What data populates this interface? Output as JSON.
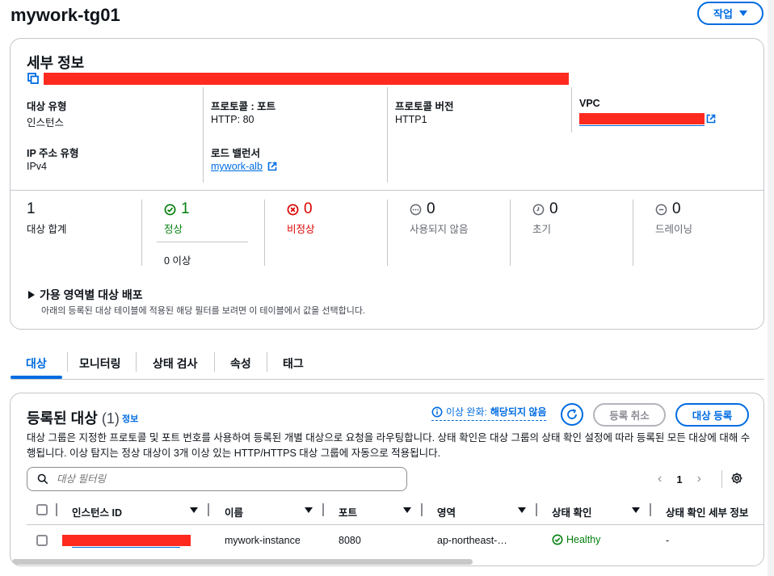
{
  "page": {
    "title": "mywork-tg01",
    "actions_label": "작업"
  },
  "details": {
    "title": "세부 정보",
    "fields": {
      "target_type": {
        "label": "대상 유형",
        "value": "인스턴스"
      },
      "protocol_port": {
        "label": "프로토콜 : 포트",
        "value": "HTTP: 80"
      },
      "protocol_version": {
        "label": "프로토콜 버전",
        "value": "HTTP1"
      },
      "vpc": {
        "label": "VPC"
      },
      "ip_type": {
        "label": "IP 주소 유형",
        "value": "IPv4"
      },
      "load_balancer": {
        "label": "로드 밸런서",
        "value": "mywork-alb"
      }
    },
    "stats": {
      "total": {
        "value": "1",
        "label": "대상 합계"
      },
      "healthy": {
        "value": "1",
        "label": "정상",
        "sub": "0 이상"
      },
      "unhealthy": {
        "value": "0",
        "label": "비정상"
      },
      "unused": {
        "value": "0",
        "label": "사용되지 않음"
      },
      "initial": {
        "value": "0",
        "label": "초기"
      },
      "draining": {
        "value": "0",
        "label": "드레이닝"
      }
    },
    "az": {
      "title": "가용 영역별 대상 배포",
      "description": "아래의 등록된 대상 테이블에 적용된 해당 필터를 보려면 이 테이블에서 값을 선택합니다."
    }
  },
  "tabs": [
    "대상",
    "모니터링",
    "상태 검사",
    "속성",
    "태그"
  ],
  "targets": {
    "title": "등록된 대상",
    "count": "(1)",
    "info": "정보",
    "relax_prefix": "이상 완화:",
    "relax_value": "해당되지 않음",
    "deregister_label": "등록 취소",
    "register_label": "대상 등록",
    "description": "대상 그룹은 지정한 프로토콜 및 포트 번호를 사용하여 등록된 개별 대상으로 요청을 라우팅합니다. 상태 확인은 대상 그룹의 상태 확인 설정에 따라 등록된 모든 대상에 대해 수행됩니다. 이상 탐지는 정상 대상이 3개 이상 있는 HTTP/HTTPS 대상 그룹에 자동으로 적용됩니다.",
    "filter_placeholder": "대상 필터링",
    "page": "1",
    "columns": {
      "instance_id": "인스턴스 ID",
      "name": "이름",
      "port": "포트",
      "zone": "영역",
      "health": "상태 확인",
      "health_detail": "상태 확인 세부 정보"
    },
    "rows": [
      {
        "name": "mywork-instance",
        "port": "8080",
        "zone": "ap-northeast-…",
        "health": "Healthy",
        "health_detail": "-"
      }
    ]
  },
  "colors": {
    "accent": "#006ce0",
    "healthy": "#037f0c",
    "unhealthy": "#db0000",
    "redaction": "#ff2a1f"
  }
}
